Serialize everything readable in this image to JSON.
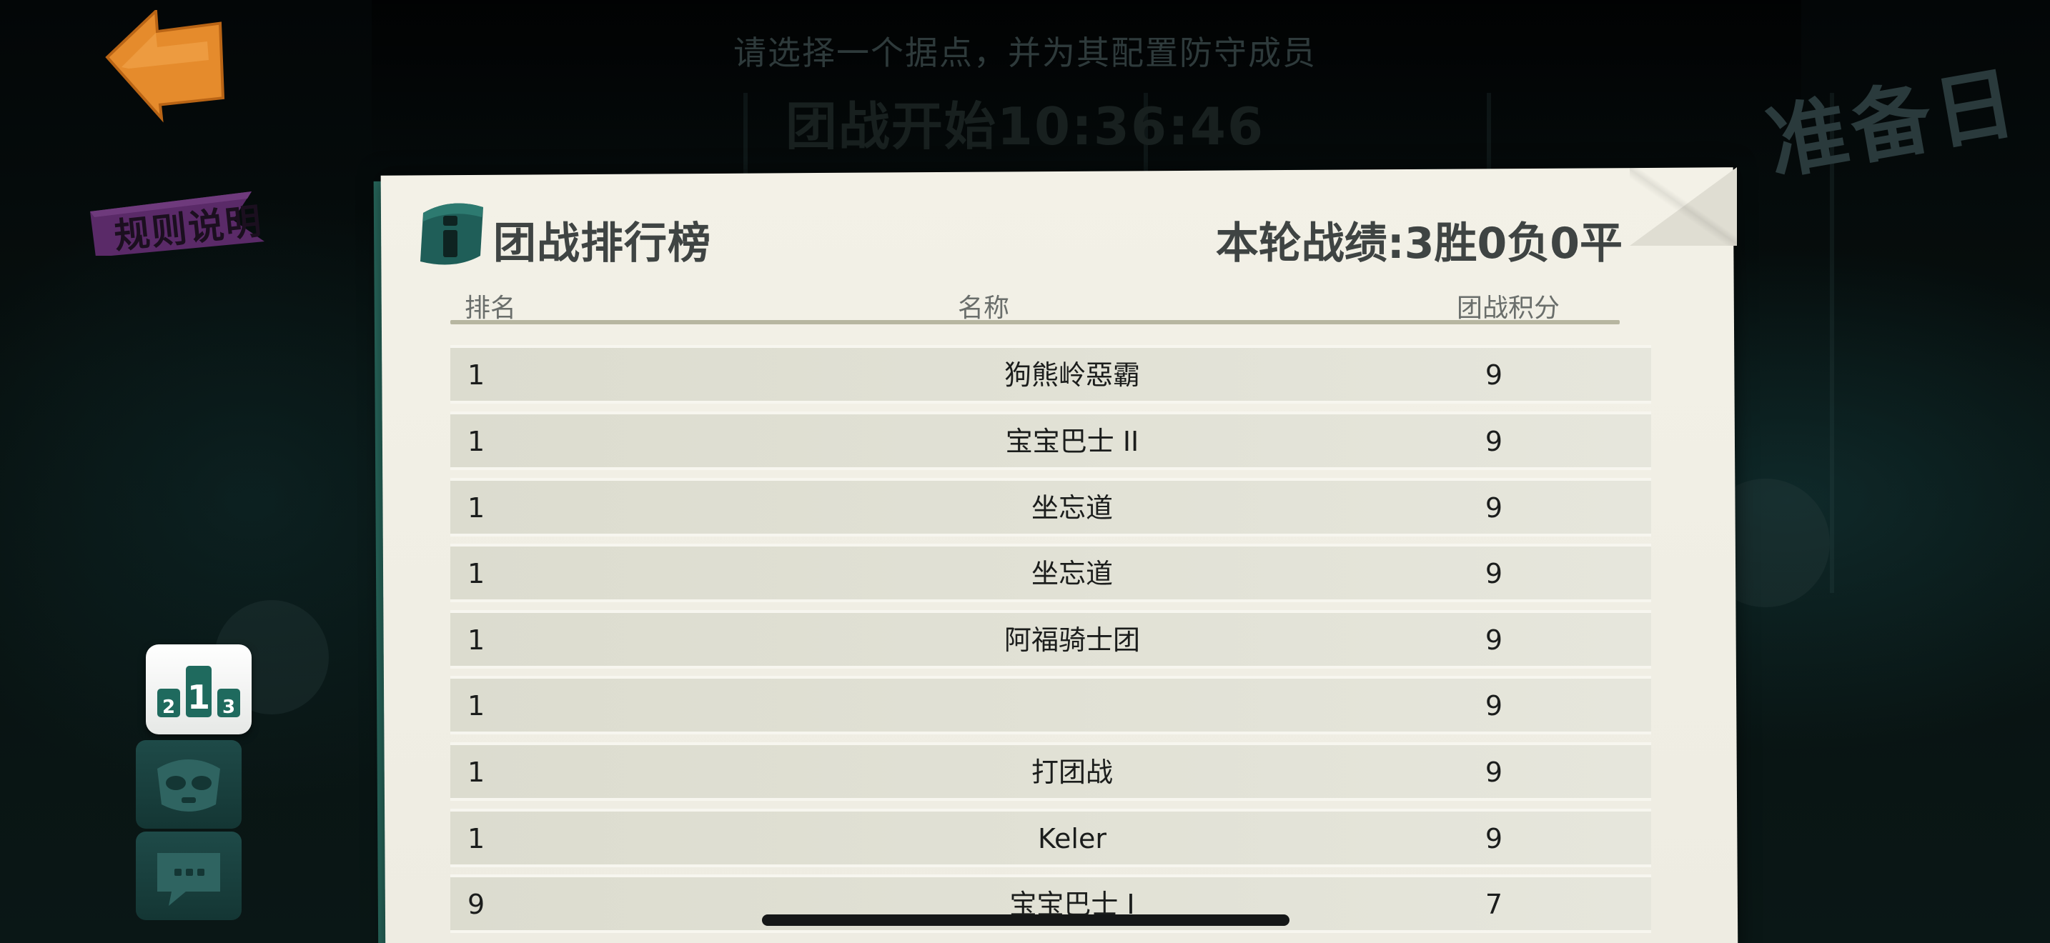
{
  "header": {
    "hint": "请选择一个据点，并为其配置防守成员",
    "timer": "团战开始10:36:46",
    "day_label": "准备日"
  },
  "buttons": {
    "rules": "规则说明"
  },
  "nav": {
    "rank_icon": "podium-icon",
    "team_icon": "skull-mask-icon",
    "chat_icon": "chat-bubble-icon"
  },
  "panel": {
    "title": "团战排行榜",
    "record": "本轮战绩:3胜0负0平",
    "columns": {
      "rank": "排名",
      "name": "名称",
      "score": "团战积分"
    },
    "rows": [
      {
        "rank": "1",
        "name": "狗熊岭惡霸",
        "score": "9"
      },
      {
        "rank": "1",
        "name": "宝宝巴士 II",
        "score": "9"
      },
      {
        "rank": "1",
        "name": "坐忘道",
        "score": "9"
      },
      {
        "rank": "1",
        "name": "坐忘道",
        "score": "9"
      },
      {
        "rank": "1",
        "name": "阿福骑士团",
        "score": "9"
      },
      {
        "rank": "1",
        "name": "",
        "score": "9"
      },
      {
        "rank": "1",
        "name": "打团战",
        "score": "9"
      },
      {
        "rank": "1",
        "name": "Keler",
        "score": "9"
      },
      {
        "rank": "9",
        "name": "宝宝巴士 I",
        "score": "7"
      }
    ]
  },
  "colors": {
    "accent_orange": "#e58b2c",
    "panel_green": "#2a6e62",
    "rules_purple": "#5a2a68",
    "paper": "#f3f1e7"
  }
}
